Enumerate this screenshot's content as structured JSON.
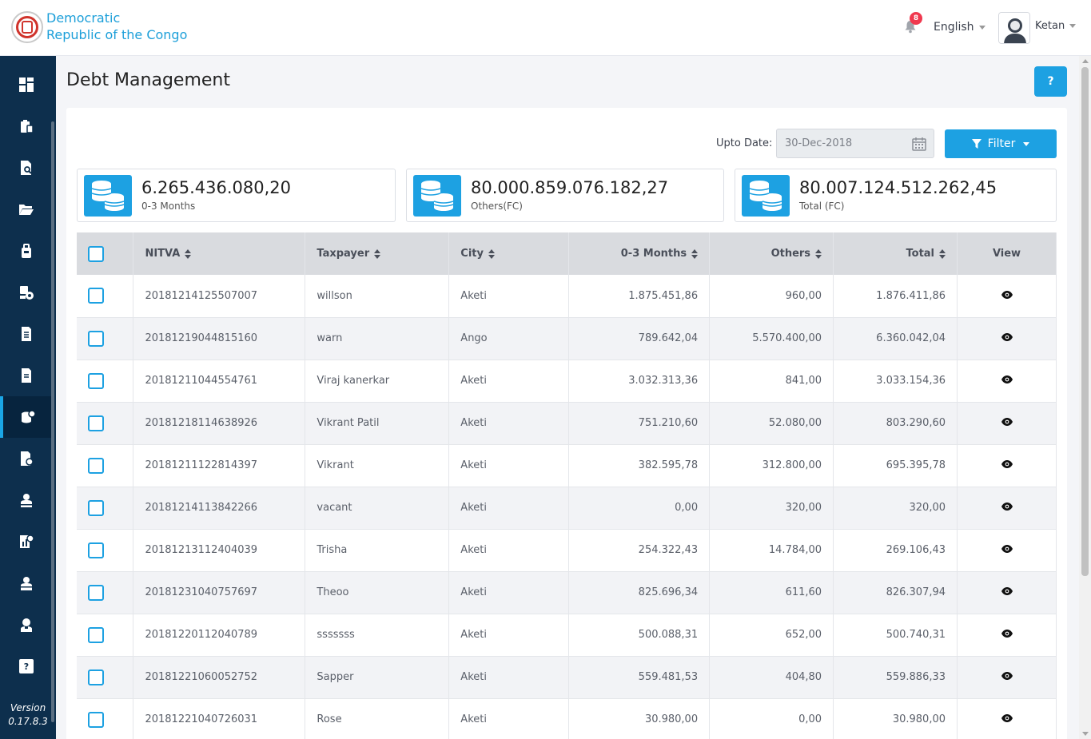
{
  "header": {
    "brand_line1": "Democratic",
    "brand_line2": "Republic of the Congo",
    "notification_count": "8",
    "language": "English",
    "username": "Ketan"
  },
  "sidebar": {
    "items": [
      {
        "icon": "dashboard-icon"
      },
      {
        "icon": "clipboard-icon"
      },
      {
        "icon": "document-search-icon"
      },
      {
        "icon": "folder-open-icon"
      },
      {
        "icon": "bag-icon"
      },
      {
        "icon": "user-settings-icon"
      },
      {
        "icon": "document-list-icon"
      },
      {
        "icon": "document-icon"
      },
      {
        "icon": "debt-icon",
        "active": true
      },
      {
        "icon": "document-info-icon"
      },
      {
        "icon": "user-icon"
      },
      {
        "icon": "report-icon"
      },
      {
        "icon": "person-icon"
      },
      {
        "icon": "support-icon"
      },
      {
        "icon": "help-icon"
      }
    ],
    "version_label": "Version",
    "version_number": "0.17.8.3"
  },
  "page": {
    "title": "Debt Management",
    "help_label": "?",
    "upto_label": "Upto Date:",
    "upto_value": "30-Dec-2018",
    "filter_label": "Filter"
  },
  "stats": [
    {
      "value": "6.265.436.080,20",
      "label": "0-3 Months"
    },
    {
      "value": "80.000.859.076.182,27",
      "label": "Others(FC)"
    },
    {
      "value": "80.007.124.512.262,45",
      "label": "Total (FC)"
    }
  ],
  "table": {
    "columns": [
      "NITVA",
      "Taxpayer",
      "City",
      "0-3 Months",
      "Others",
      "Total",
      "View"
    ],
    "rows": [
      [
        "20181214125507007",
        "willson",
        "Aketi",
        "1.875.451,86",
        "960,00",
        "1.876.411,86"
      ],
      [
        "20181219044815160",
        "warn",
        "Ango",
        "789.642,04",
        "5.570.400,00",
        "6.360.042,04"
      ],
      [
        "20181211044554761",
        "Viraj kanerkar",
        "Aketi",
        "3.032.313,36",
        "841,00",
        "3.033.154,36"
      ],
      [
        "20181218114638926",
        "Vikrant Patil",
        "Aketi",
        "751.210,60",
        "52.080,00",
        "803.290,60"
      ],
      [
        "20181211122814397",
        "Vikrant",
        "Aketi",
        "382.595,78",
        "312.800,00",
        "695.395,78"
      ],
      [
        "20181214113842266",
        "vacant",
        "Aketi",
        "0,00",
        "320,00",
        "320,00"
      ],
      [
        "20181213112404039",
        "Trisha",
        "Aketi",
        "254.322,43",
        "14.784,00",
        "269.106,43"
      ],
      [
        "20181231040757697",
        "Theoo",
        "Aketi",
        "825.696,34",
        "611,60",
        "826.307,94"
      ],
      [
        "20181220112040789",
        "sssssss",
        "Aketi",
        "500.088,31",
        "652,00",
        "500.740,31"
      ],
      [
        "20181221060052752",
        "Sapper",
        "Aketi",
        "559.481,53",
        "404,80",
        "559.886,33"
      ],
      [
        "20181221040726031",
        "Rose",
        "Aketi",
        "30.980,00",
        "0,00",
        "30.980,00"
      ]
    ]
  },
  "colors": {
    "accent": "#1da1e2",
    "sidebar": "#0d2f4d",
    "badge": "#f0384e"
  }
}
